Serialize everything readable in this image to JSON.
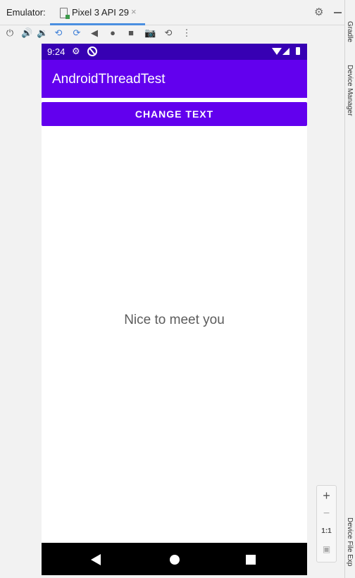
{
  "emulator": {
    "label": "Emulator:",
    "tab_name": "Pixel 3 API 29",
    "tab_close": "×"
  },
  "toolbar_icons": [
    "power-icon",
    "volume-up-icon",
    "volume-down-icon",
    "rotate-left-icon",
    "rotate-right-icon",
    "back-icon",
    "home-icon",
    "overview-icon",
    "screenshot-icon",
    "snapshot-icon",
    "more-icon"
  ],
  "side_panels": {
    "gradle": "Gradle",
    "device_manager": "Device Manager",
    "device_file_explorer": "Device File Exp"
  },
  "status_bar": {
    "time": "9:24"
  },
  "app": {
    "title": "AndroidThreadTest",
    "button_label": "CHANGE TEXT",
    "message": "Nice to meet you"
  },
  "zoom": {
    "in": "+",
    "out": "−",
    "one_to_one": "1:1"
  },
  "colors": {
    "primary": "#6200ee",
    "primary_dark": "#3700b3",
    "accent_tab": "#4a8fe0"
  }
}
